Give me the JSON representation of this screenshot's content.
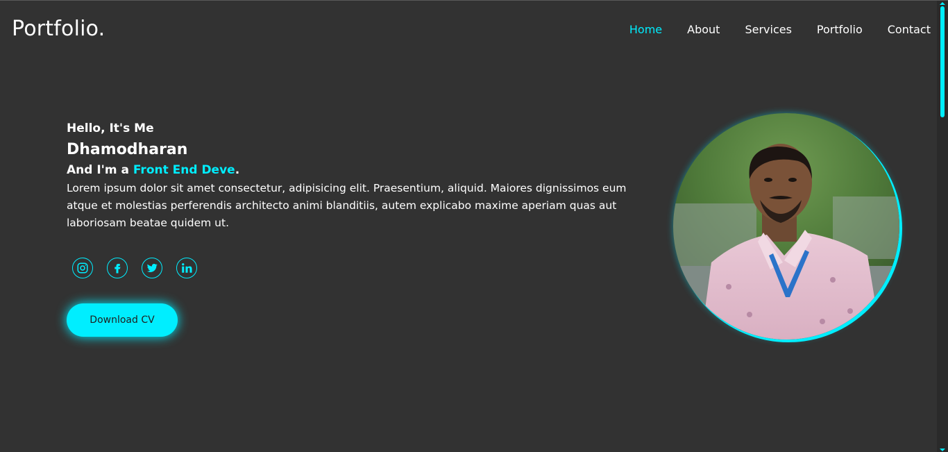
{
  "header": {
    "logo": "Portfolio.",
    "nav": [
      {
        "label": "Home",
        "active": true
      },
      {
        "label": "About",
        "active": false
      },
      {
        "label": "Services",
        "active": false
      },
      {
        "label": "Portfolio",
        "active": false
      },
      {
        "label": "Contact",
        "active": false
      }
    ]
  },
  "hero": {
    "greeting": "Hello, It's Me",
    "name": "Dhamodharan",
    "role_prefix": "And I'm a ",
    "role_highlight": "Front End Deve",
    "role_suffix": ".",
    "description": "Lorem ipsum dolor sit amet consectetur, adipisicing elit. Praesentium, aliquid. Maiores dignissimos eum atque et molestias perferendis architecto animi blanditiis, autem explicabo maxime aperiam quas aut laboriosam beatae quidem ut.",
    "download_label": "Download CV"
  },
  "socials": [
    {
      "icon": "instagram-icon"
    },
    {
      "icon": "facebook-icon"
    },
    {
      "icon": "twitter-icon"
    },
    {
      "icon": "linkedin-icon"
    }
  ],
  "colors": {
    "background": "#323232",
    "accent": "#00eeff",
    "text": "#ffffff"
  }
}
